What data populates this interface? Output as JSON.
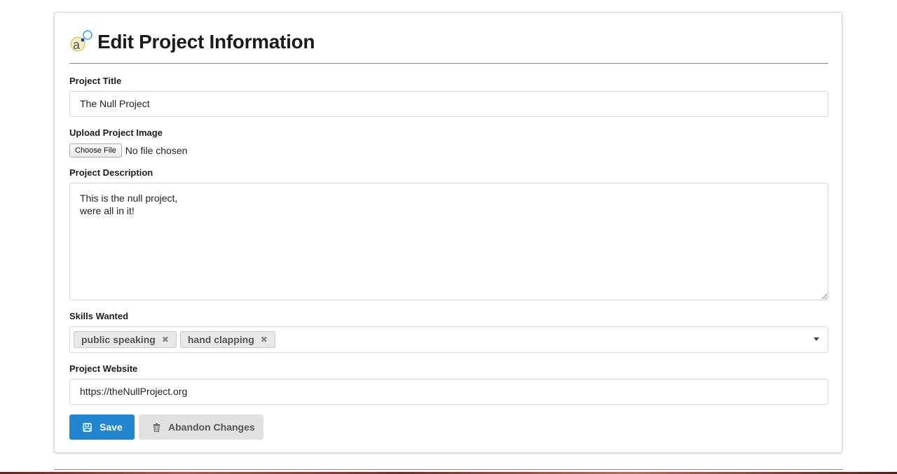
{
  "page": {
    "title": "Edit Project Information"
  },
  "form": {
    "title_label": "Project Title",
    "title_value": "The Null Project",
    "image_label": "Upload Project Image",
    "file_button": "Choose File",
    "file_status": "No file chosen",
    "description_label": "Project Description",
    "description_value": "This is the null project,\nwere all in it!",
    "skills_label": "Skills Wanted",
    "skills": [
      {
        "label": "public speaking",
        "remove": "✖"
      },
      {
        "label": "hand clapping",
        "remove": "✖"
      }
    ],
    "website_label": "Project Website",
    "website_value": "https://theNullProject.org"
  },
  "actions": {
    "save_label": "Save",
    "abandon_label": "Abandon Changes"
  },
  "icons": {
    "logo": "logo-icon",
    "save": "floppy-disk-icon",
    "abandon": "trash-icon",
    "remove_chip": "close-icon",
    "dropdown": "caret-down-icon"
  },
  "colors": {
    "primary": "#2185d0",
    "secondary": "#e0e1e2"
  }
}
